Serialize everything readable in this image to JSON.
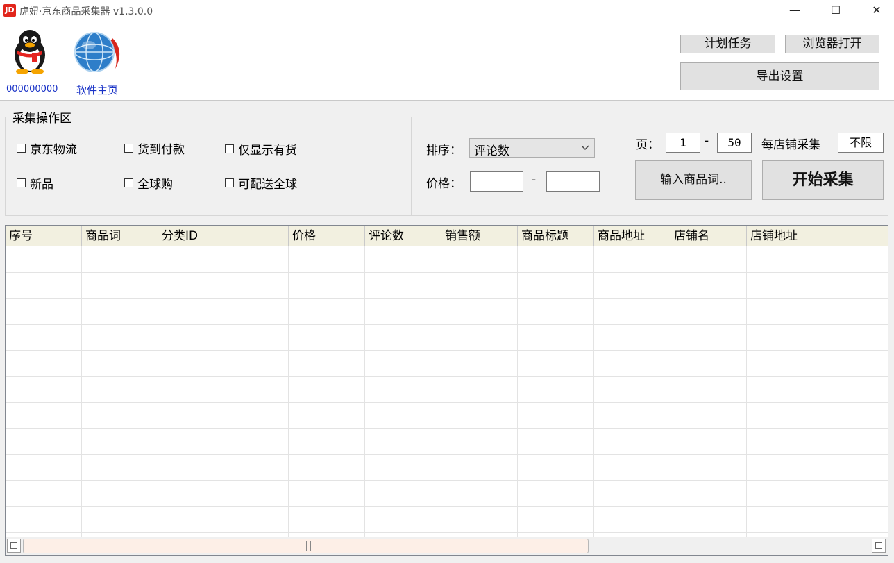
{
  "window": {
    "icon_text": "JD",
    "title": "虎妞·京东商品采集器 v1.3.0.0",
    "minimize": "—",
    "maximize": "☐",
    "close": "✕"
  },
  "header": {
    "qq_number": "000000000",
    "homepage_label": "软件主页",
    "plan_task_label": "计划任务",
    "browser_open_label": "浏览器打开",
    "export_settings_label": "导出设置"
  },
  "ops": {
    "group_title": "采集操作区",
    "checkboxes": [
      "京东物流",
      "货到付款",
      "仅显示有货",
      "新品",
      "全球购",
      "可配送全球"
    ],
    "sort_label": "排序：",
    "sort_value": "评论数",
    "price_label": "价格：",
    "price_sep": "-",
    "price_min": "",
    "price_max": "",
    "page_label": "页：",
    "page_from": "1",
    "page_sep": "-",
    "page_to": "50",
    "per_store_label": "每店铺采集",
    "per_store_value": "不限",
    "input_keywords_label": "输入商品词..",
    "start_label": "开始采集"
  },
  "table": {
    "columns": [
      "序号",
      "商品词",
      "分类ID",
      "价格",
      "评论数",
      "销售额",
      "商品标题",
      "商品地址",
      "店铺名",
      "店铺地址"
    ],
    "rows": []
  },
  "icons": {
    "qq": "qq-penguin-icon",
    "home": "globe-icon",
    "dropdown": "chevron-down-icon"
  },
  "colors": {
    "accent_link": "#1a33c7",
    "jd_red": "#e1251b",
    "header_bg": "#f2f0e0",
    "scroll_thumb": "#fdefe7"
  }
}
